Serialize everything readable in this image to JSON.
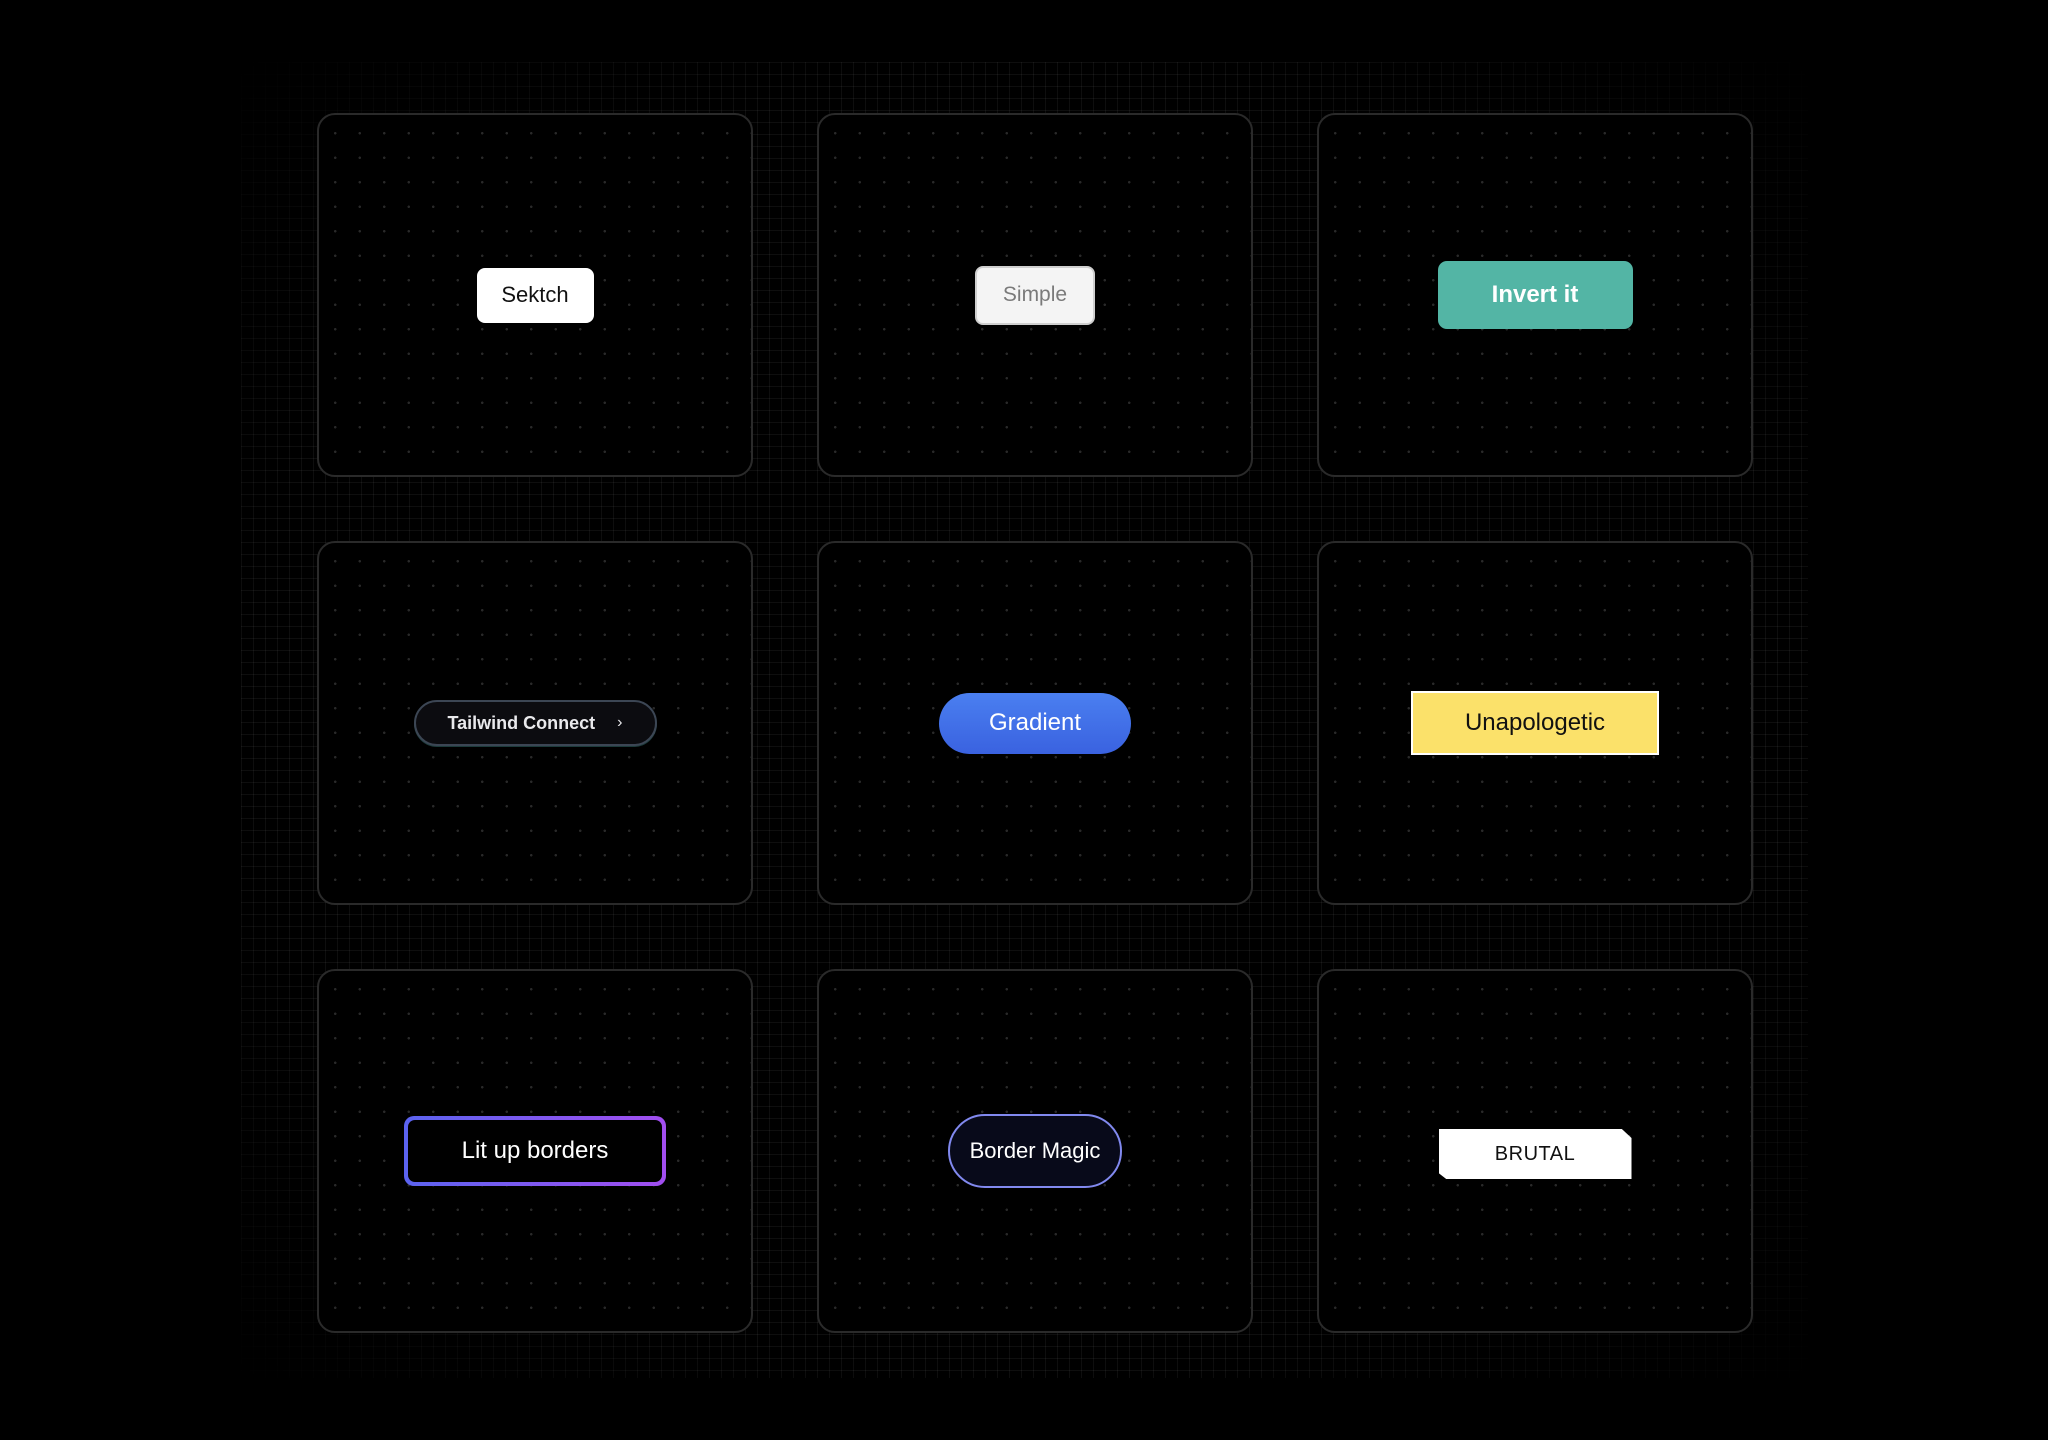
{
  "buttons": {
    "sketch": {
      "label": "Sektch"
    },
    "simple": {
      "label": "Simple"
    },
    "invert": {
      "label": "Invert it",
      "color": "#53b5a5"
    },
    "tailwind": {
      "label": "Tailwind Connect",
      "icon": "chevron-right-icon",
      "icon_glyph": "›"
    },
    "gradient": {
      "label": "Gradient",
      "color": "#3f6ee8"
    },
    "unapologetic": {
      "label": "Unapologetic",
      "color": "#fbe16a"
    },
    "lit": {
      "label": "Lit up borders",
      "gradient_from": "#5b63f0",
      "gradient_to": "#a24ef0"
    },
    "magic": {
      "label": "Border Magic"
    },
    "brutal": {
      "label": "BRUTAL"
    }
  }
}
